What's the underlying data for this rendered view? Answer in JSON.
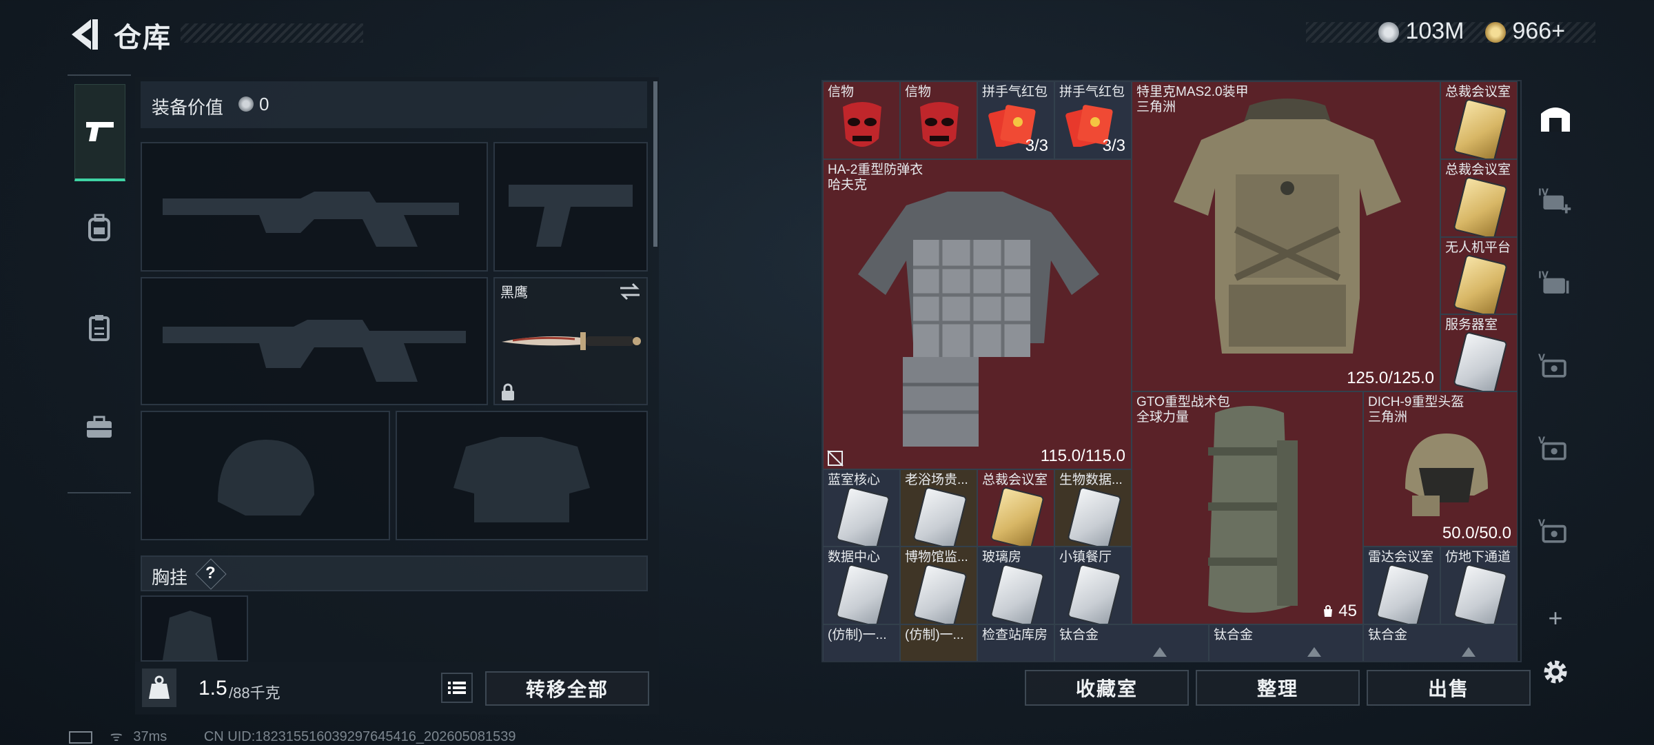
{
  "header": {
    "title": "仓库",
    "back_icon": "back-arrow-icon",
    "currency": [
      {
        "icon": "silver-coin-icon",
        "value": "103M"
      },
      {
        "icon": "gold-triangle-coin-icon",
        "value": "966"
      }
    ],
    "plus_label": "+"
  },
  "rail": {
    "items": [
      {
        "name": "weapon",
        "icon": "pistol-icon"
      },
      {
        "name": "backpack",
        "icon": "backpack-icon"
      },
      {
        "name": "vest",
        "icon": "clipboard-icon"
      },
      {
        "name": "case",
        "icon": "briefcase-icon"
      }
    ]
  },
  "loadout": {
    "equip_value_label": "装备价值",
    "equip_value": "0",
    "knife_name": "黑鹰",
    "chest_rig_label": "胸挂",
    "help": "?",
    "weight_current": "1.5",
    "weight_max": "/88千克",
    "weight_icon": "KG",
    "transfer_all": "转移全部"
  },
  "stash": {
    "items": [
      {
        "name": "信物",
        "kind": "mask"
      },
      {
        "name": "信物",
        "kind": "mask"
      },
      {
        "name": "拼手气红包",
        "count": "3/3"
      },
      {
        "name": "拼手气红包",
        "count": "3/3"
      },
      {
        "name": "特里克MAS2.0装甲",
        "sub": "三角洲",
        "durability": "125.0/125.0"
      },
      {
        "name": "总裁会议室"
      },
      {
        "name": "总裁会议室"
      },
      {
        "name": "无人机平台"
      },
      {
        "name": "服务器室"
      },
      {
        "name": "HA-2重型防弹衣",
        "sub": "哈夫克",
        "durability": "115.0/115.0"
      },
      {
        "name": "GTO重型战术包",
        "sub": "全球力量",
        "count": "45"
      },
      {
        "name": "DICH-9重型头盔",
        "sub": "三角洲",
        "durability": "50.0/50.0"
      },
      {
        "name": "蓝室核心"
      },
      {
        "name": "老浴场贵..."
      },
      {
        "name": "总裁会议室"
      },
      {
        "name": "生物数据..."
      },
      {
        "name": "数据中心"
      },
      {
        "name": "博物馆监..."
      },
      {
        "name": "玻璃房"
      },
      {
        "name": "小镇餐厅"
      },
      {
        "name": "雷达会议室"
      },
      {
        "name": "仿地下通道"
      },
      {
        "name": "(仿制)一..."
      },
      {
        "name": "(仿制)一..."
      },
      {
        "name": "检查站库房"
      },
      {
        "name": "钛合金"
      },
      {
        "name": "钛合金"
      },
      {
        "name": "钛合金"
      }
    ],
    "buttons": {
      "collection": "收藏室",
      "sort": "整理",
      "sell": "出售"
    }
  },
  "right_rail": {
    "items": [
      {
        "icon": "safe-box-icon"
      },
      {
        "label": "IV",
        "icon": "card-add-icon"
      },
      {
        "label": "IV",
        "icon": "card-icon"
      },
      {
        "label": "V",
        "icon": "key-icon"
      },
      {
        "label": "V",
        "icon": "key-icon"
      },
      {
        "label": "V",
        "icon": "key-icon"
      }
    ],
    "add": "+",
    "settings_icon": "gear-icon"
  },
  "status": {
    "ping": "37ms",
    "uid": "CN UID:18231551603929764541​6_202605081539"
  }
}
